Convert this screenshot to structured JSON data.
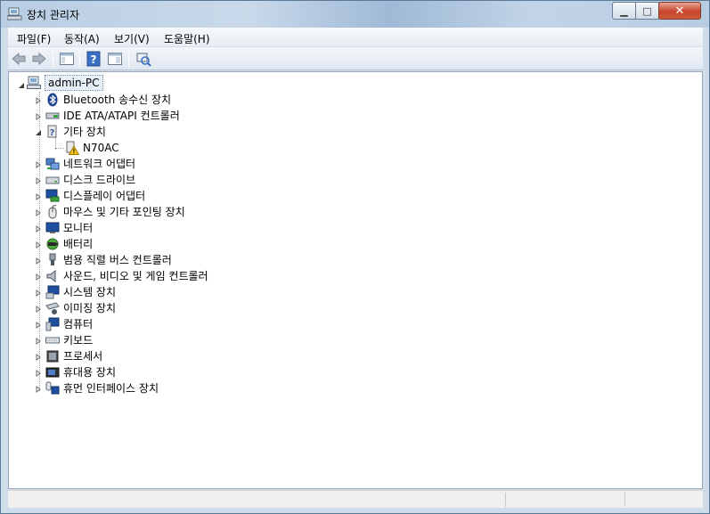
{
  "window": {
    "title": "장치 관리자"
  },
  "menubar": {
    "items": [
      {
        "label": "파일(F)"
      },
      {
        "label": "동작(A)"
      },
      {
        "label": "보기(V)"
      },
      {
        "label": "도움말(H)"
      }
    ]
  },
  "toolbar": {
    "buttons": [
      "back-arrow-icon",
      "forward-arrow-icon",
      "show-hide-tree-icon",
      "help-icon",
      "properties-icon",
      "scan-hardware-icon"
    ]
  },
  "tree": {
    "root": {
      "label": "admin-PC",
      "expanded": true
    },
    "categories": [
      {
        "label": "Bluetooth 송수신 장치",
        "icon": "bluetooth-icon",
        "expanded": false
      },
      {
        "label": "IDE ATA/ATAPI 컨트롤러",
        "icon": "ide-controller-icon",
        "expanded": false
      },
      {
        "label": "기타 장치",
        "icon": "unknown-device-icon",
        "expanded": true,
        "children": [
          {
            "label": "N70AC",
            "icon": "warning-device-icon"
          }
        ]
      },
      {
        "label": "네트워크 어댑터",
        "icon": "network-adapter-icon",
        "expanded": false
      },
      {
        "label": "디스크 드라이브",
        "icon": "disk-drive-icon",
        "expanded": false
      },
      {
        "label": "디스플레이 어댑터",
        "icon": "display-adapter-icon",
        "expanded": false
      },
      {
        "label": "마우스 및 기타 포인팅 장치",
        "icon": "mouse-icon",
        "expanded": false
      },
      {
        "label": "모니터",
        "icon": "monitor-icon",
        "expanded": false
      },
      {
        "label": "배터리",
        "icon": "battery-icon",
        "expanded": false
      },
      {
        "label": "범용 직렬 버스 컨트롤러",
        "icon": "usb-icon",
        "expanded": false
      },
      {
        "label": "사운드, 비디오 및 게임 컨트롤러",
        "icon": "speaker-icon",
        "expanded": false
      },
      {
        "label": "시스템 장치",
        "icon": "system-device-icon",
        "expanded": false
      },
      {
        "label": "이미징 장치",
        "icon": "imaging-device-icon",
        "expanded": false
      },
      {
        "label": "컴퓨터",
        "icon": "computer-icon",
        "expanded": false
      },
      {
        "label": "키보드",
        "icon": "keyboard-icon",
        "expanded": false
      },
      {
        "label": "프로세서",
        "icon": "processor-icon",
        "expanded": false
      },
      {
        "label": "휴대용 장치",
        "icon": "portable-device-icon",
        "expanded": false
      },
      {
        "label": "휴먼 인터페이스 장치",
        "icon": "hid-icon",
        "expanded": false
      }
    ]
  },
  "colors": {
    "titlebar": "#b9cde3",
    "selection": "#e6eef7",
    "close": "#c7452d"
  }
}
